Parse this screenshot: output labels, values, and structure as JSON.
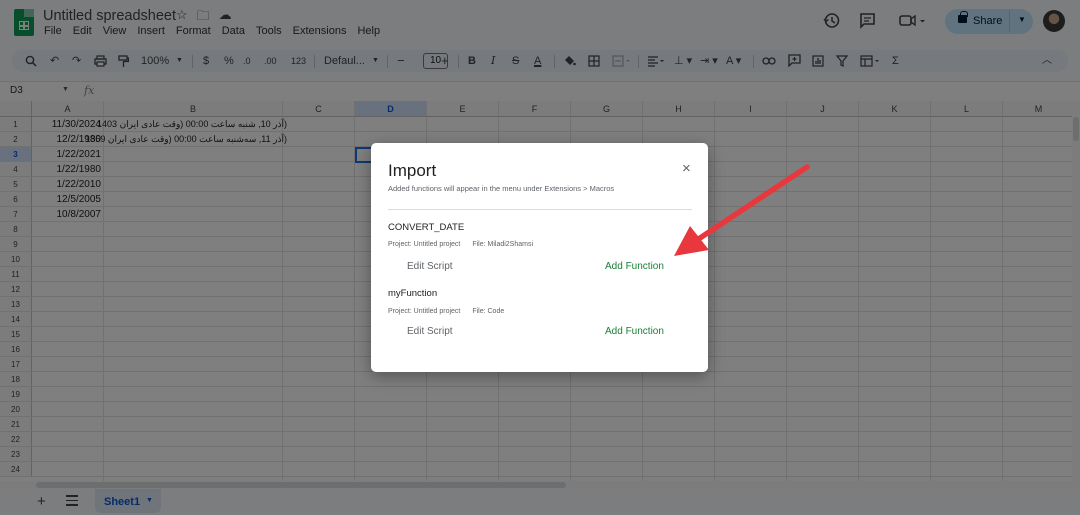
{
  "header": {
    "doc_title": "Untitled spreadsheet",
    "menus": [
      "File",
      "Edit",
      "View",
      "Insert",
      "Format",
      "Data",
      "Tools",
      "Extensions",
      "Help"
    ],
    "share_label": "Share"
  },
  "toolbar": {
    "zoom": "100%",
    "currency": "$",
    "percent": "%",
    "dec_minus": ".0",
    "dec_plus": ".00",
    "more_formats": "123",
    "font": "Defaul...",
    "font_size": "10"
  },
  "formula_bar": {
    "name_box": "D3",
    "fx": "fx"
  },
  "grid": {
    "columns": [
      "A",
      "B",
      "C",
      "D",
      "E",
      "F",
      "G",
      "H",
      "I",
      "J",
      "K",
      "L",
      "M"
    ],
    "rows": [
      "1",
      "2",
      "3",
      "4",
      "5",
      "6",
      "7",
      "8",
      "9",
      "10",
      "11",
      "12",
      "13",
      "14",
      "15",
      "16",
      "17",
      "18",
      "19",
      "20",
      "21",
      "22",
      "23",
      "24"
    ],
    "selected_column": "D",
    "selected_row": "3",
    "column_a": [
      "11/30/2024",
      "12/2/1980",
      "1/22/2021",
      "1/22/1980",
      "1/22/2010",
      "12/5/2005",
      "10/8/2007"
    ],
    "column_b": [
      "(آذر 10, شنبه ساعت 00:00 (وقت عادی ایران 1403",
      "(آذر 11, سه‌شنبه ساعت 00:00 (وقت عادی ایران 1359"
    ]
  },
  "sheet_tabs": {
    "active": "Sheet1"
  },
  "dialog": {
    "title": "Import",
    "close": "×",
    "subtitle": "Added functions will appear in the menu under Extensions > Macros",
    "functions": [
      {
        "name": "CONVERT_DATE",
        "project": "Project: Untitled project",
        "file": "File: Miladi2Shamsi",
        "edit_label": "Edit Script",
        "add_label": "Add Function"
      },
      {
        "name": "myFunction",
        "project": "Project: Untitled project",
        "file": "File: Code",
        "edit_label": "Edit Script",
        "add_label": "Add Function"
      }
    ]
  },
  "colors": {
    "accent_green": "#188038",
    "annotation_arrow": "#e8383d",
    "share_button": "#c2e7ff",
    "selection_blue": "#1a73e8"
  }
}
